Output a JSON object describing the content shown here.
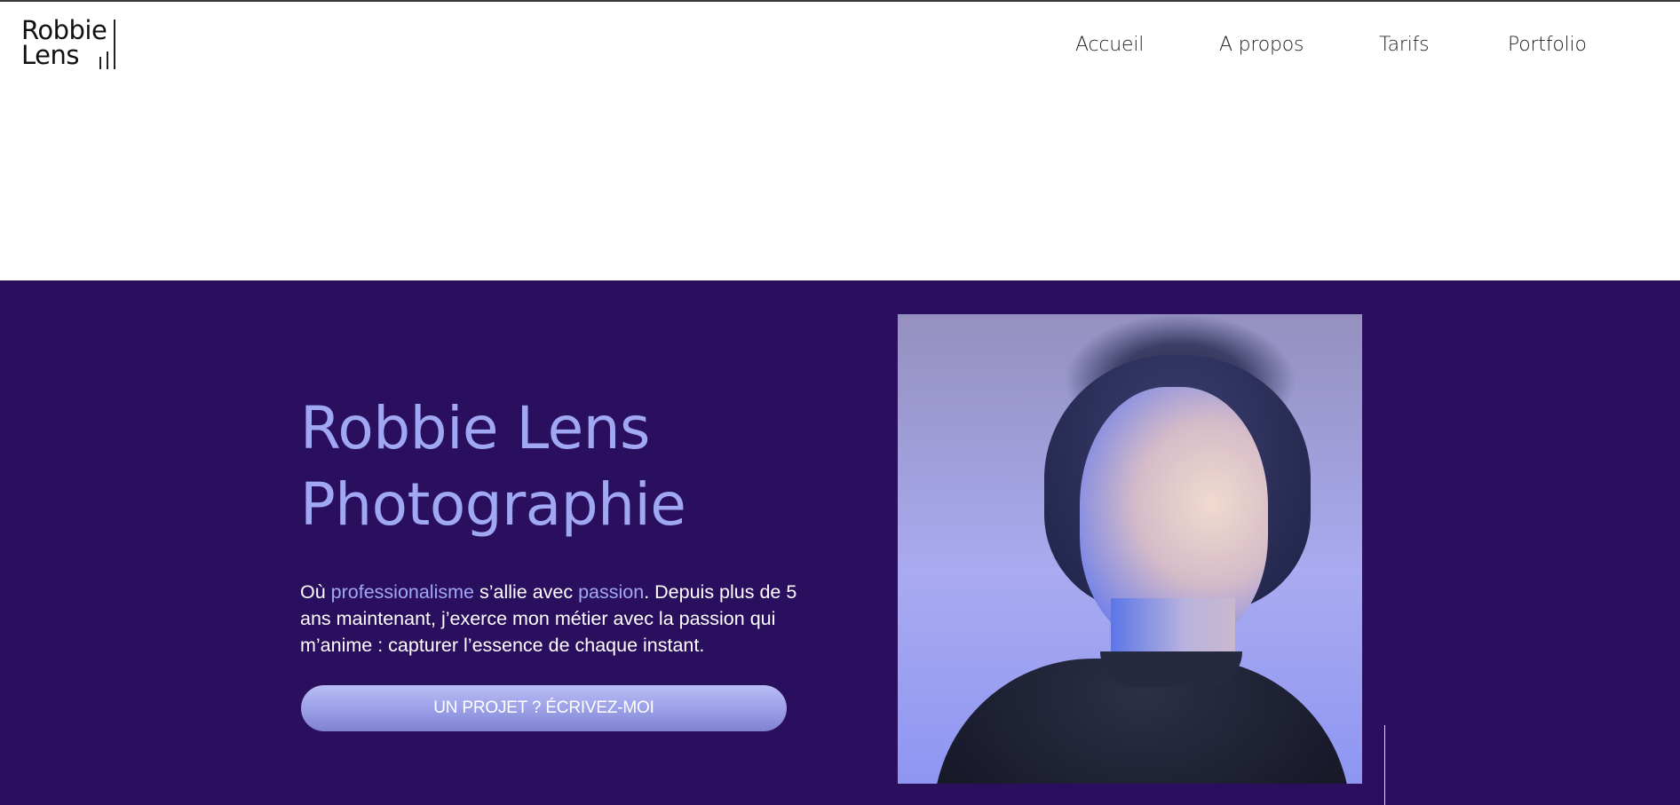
{
  "brand": {
    "line1": "Robbie",
    "line2": "Lens"
  },
  "nav": {
    "items": [
      {
        "label": "Accueil"
      },
      {
        "label": "A propos"
      },
      {
        "label": "Tarifs"
      },
      {
        "label": "Portfolio"
      }
    ]
  },
  "hero": {
    "title_line1": "Robbie Lens",
    "title_line2": "Photographie",
    "text_prefix": "Où ",
    "text_hl1": "professionalisme",
    "text_mid": " s’allie avec ",
    "text_hl2": "passion",
    "text_rest": ". Depuis plus de 5 ans maintenant, j’exerce mon métier avec la passion qui m’anime : capturer l’essence de chaque instant.",
    "cta_label": "UN PROJET ? ÉCRIVEZ-MOI"
  },
  "colors": {
    "hero_bg": "#2a0f5e",
    "accent": "#a0a8f4",
    "cta_gradient_top": "#b9bdf4",
    "cta_gradient_bottom": "#7f82d2"
  },
  "icons": {
    "logo_mark": "vertical-bars-logo-mark"
  }
}
